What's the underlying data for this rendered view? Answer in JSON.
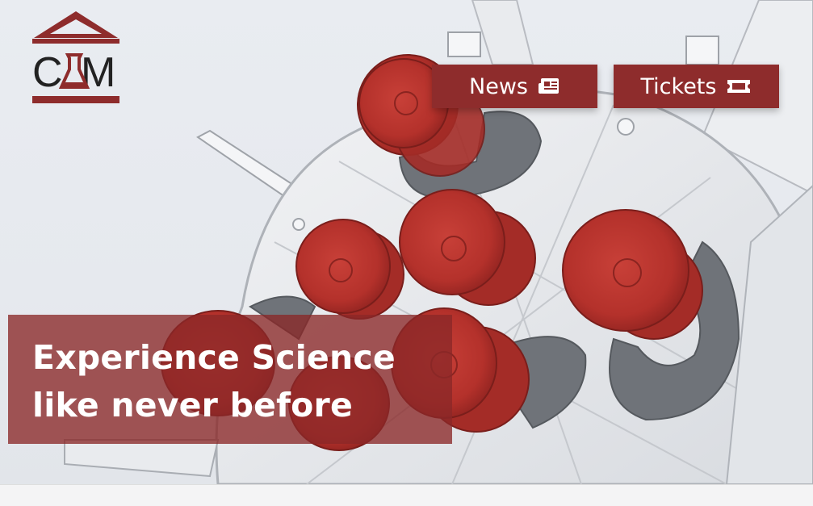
{
  "brand": {
    "logo_text": "C M",
    "logo_color": "#8e2c2c"
  },
  "nav": {
    "news_label": "News",
    "news_icon": "newspaper-icon",
    "tickets_label": "Tickets",
    "tickets_icon": "ticket-icon",
    "button_color": "#8e2c2c"
  },
  "hero": {
    "headline_line1": "Experience Science",
    "headline_line2": "like never before",
    "image_subject": "rocket-engine-nozzles"
  }
}
